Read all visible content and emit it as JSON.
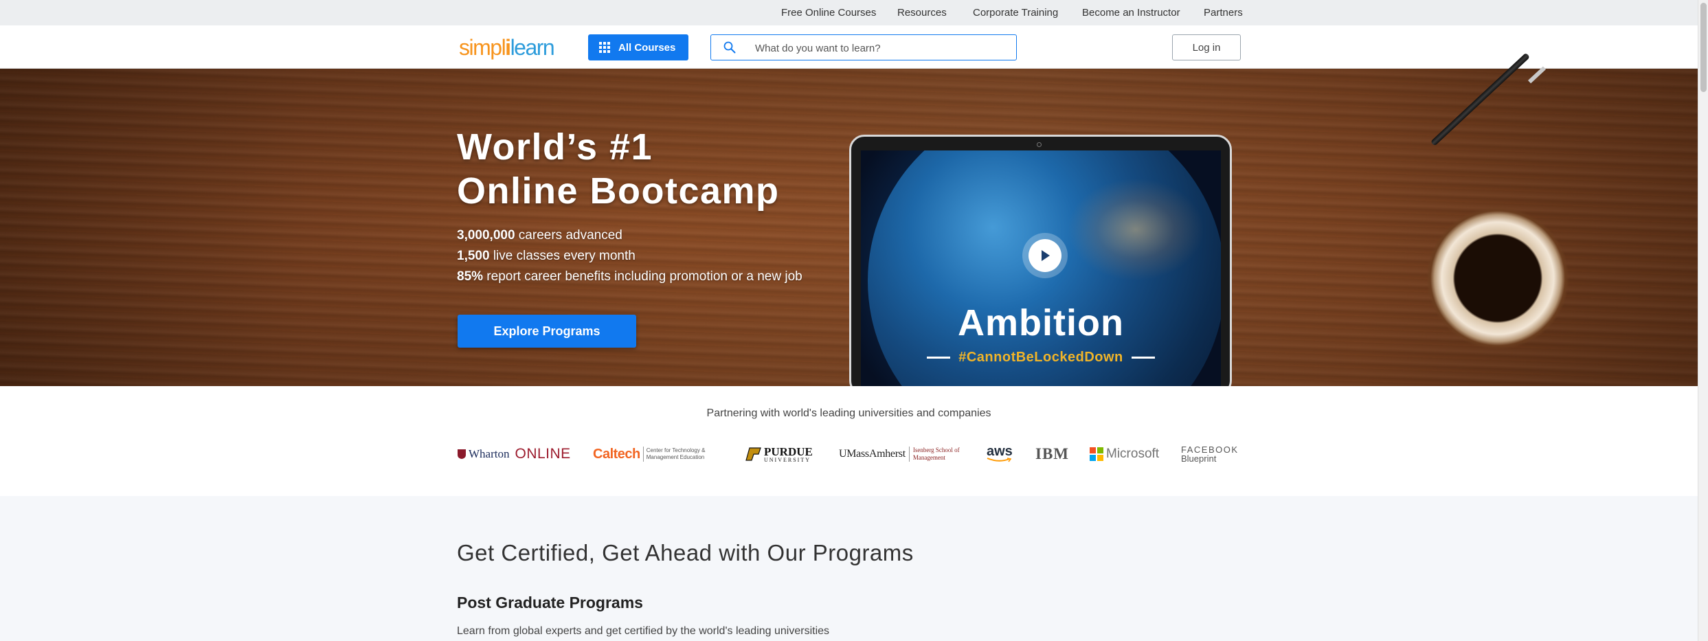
{
  "topnav": {
    "links": [
      "Free Online Courses",
      "Resources",
      "Corporate Training",
      "Become an Instructor",
      "Partners"
    ]
  },
  "navbar": {
    "logo": {
      "part1": "simpl",
      "separator": "i",
      "part2": "learn"
    },
    "all_courses_label": "All Courses",
    "search_placeholder": "What do you want to learn?",
    "login_label": "Log in"
  },
  "hero": {
    "title_line1": "World’s #1",
    "title_line2": "Online Bootcamp",
    "stats": [
      {
        "value": "3,000,000",
        "text": " careers advanced"
      },
      {
        "value": "1,500",
        "text": " live classes every month"
      },
      {
        "value": "85%",
        "text": " report career benefits including promotion or a new job"
      }
    ],
    "cta_label": "Explore Programs",
    "video": {
      "title": "Ambition",
      "tagline": "#CannotBeLockedDown"
    }
  },
  "partners": {
    "heading": "Partnering with world's leading universities and companies",
    "logos": [
      {
        "name": "Wharton",
        "extra": "ONLINE"
      },
      {
        "name": "Caltech",
        "extra": "Center for Technology & Management Education"
      },
      {
        "name": "PURDUE",
        "extra": "UNIVERSITY"
      },
      {
        "name": "UMassAmherst",
        "extra": "Isenberg School of Management"
      },
      {
        "name": "aws",
        "extra": ""
      },
      {
        "name": "IBM",
        "extra": ""
      },
      {
        "name": "Microsoft",
        "extra": ""
      },
      {
        "name": "FACEBOOK",
        "extra": "Blueprint"
      }
    ]
  },
  "programs": {
    "title": "Get Certified, Get Ahead with Our Programs",
    "subtitle": "Post Graduate Programs",
    "description": "Learn from global experts and get certified by the world's leading universities"
  },
  "colors": {
    "brand_blue": "#1179ef",
    "logo_orange": "#f7941d",
    "logo_blue": "#2d9cdb",
    "tagline_gold": "#f0b429"
  }
}
